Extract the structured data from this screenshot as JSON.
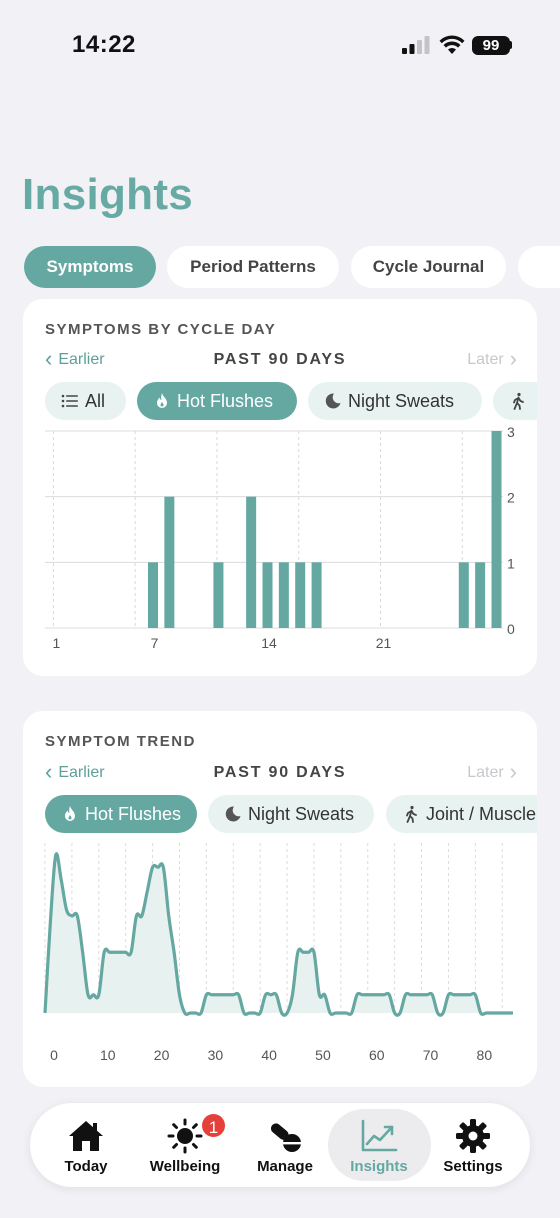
{
  "status": {
    "time": "14:22",
    "battery": "99"
  },
  "page_title": "Insights",
  "top_tabs": [
    {
      "label": "Symptoms",
      "active": true
    },
    {
      "label": "Period Patterns",
      "active": false
    },
    {
      "label": "Cycle Journal",
      "active": false
    }
  ],
  "card1": {
    "title": "SYMPTOMS BY CYCLE DAY",
    "nav_earlier": "Earlier",
    "nav_range": "PAST 90 DAYS",
    "nav_later": "Later",
    "filters": [
      {
        "label": "All",
        "icon": "list-icon",
        "active": false
      },
      {
        "label": "Hot Flushes",
        "icon": "flame-icon",
        "active": true
      },
      {
        "label": "Night Sweats",
        "icon": "moon-icon",
        "active": false
      }
    ]
  },
  "card2": {
    "title": "SYMPTOM TREND",
    "nav_earlier": "Earlier",
    "nav_range": "PAST 90 DAYS",
    "nav_later": "Later",
    "filters": [
      {
        "label": "Hot Flushes",
        "icon": "flame-icon",
        "active": true
      },
      {
        "label": "Night Sweats",
        "icon": "moon-icon",
        "active": false
      },
      {
        "label": "Joint / Muscle",
        "icon": "walking-icon",
        "active": false
      }
    ]
  },
  "tab_bar": {
    "items": [
      {
        "label": "Today",
        "icon": "home-icon",
        "active": false
      },
      {
        "label": "Wellbeing",
        "icon": "sun-icon",
        "active": false,
        "badge": "1"
      },
      {
        "label": "Manage",
        "icon": "pills-icon",
        "active": false
      },
      {
        "label": "Insights",
        "icon": "chart-trend-icon",
        "active": true
      },
      {
        "label": "Settings",
        "icon": "gear-icon",
        "active": false
      }
    ]
  },
  "colors": {
    "accent": "#65a8a2",
    "accent_light": "#e8f3f1",
    "badge": "#e5403a"
  },
  "chart_data": [
    {
      "type": "bar",
      "x": [
        7,
        8,
        11,
        13,
        14,
        15,
        16,
        17,
        26,
        27,
        28
      ],
      "values": [
        1,
        2,
        1,
        2,
        1,
        1,
        1,
        1,
        1,
        1,
        3
      ],
      "xticks": [
        1,
        7,
        14,
        21
      ],
      "yticks": [
        0,
        1,
        2,
        3
      ],
      "xlim": [
        0,
        28
      ],
      "ylim": [
        0,
        3
      ],
      "grid": true
    },
    {
      "type": "area",
      "x": [
        0,
        1,
        2,
        3,
        4,
        5,
        6,
        7,
        8,
        9,
        10,
        11,
        12,
        13,
        14,
        15,
        16,
        17,
        18,
        19,
        20,
        21,
        22,
        23,
        24,
        25,
        26,
        27,
        28,
        29,
        30,
        31,
        32,
        33,
        34,
        35,
        36,
        37,
        38,
        39,
        40,
        41,
        42,
        43,
        44,
        45,
        46,
        47,
        48,
        49,
        50,
        51,
        52,
        53,
        54,
        55,
        56,
        57,
        58,
        59,
        60,
        61,
        62,
        63,
        64,
        65,
        66,
        67,
        68,
        69,
        70,
        71,
        72,
        73,
        74,
        75,
        76,
        77,
        78,
        79,
        80,
        81,
        82,
        83,
        84,
        85,
        86,
        87
      ],
      "values": [
        0,
        1.5,
        2.6,
        2.2,
        1.7,
        1.6,
        1.6,
        1.0,
        0.3,
        0.3,
        0.3,
        1.0,
        1.0,
        1.0,
        1.0,
        1.0,
        1.0,
        1.6,
        1.6,
        2.0,
        2.4,
        2.4,
        2.4,
        1.6,
        1.0,
        0.3,
        0,
        0,
        0,
        0,
        0.3,
        0.3,
        0.3,
        0.3,
        0.3,
        0.3,
        0.3,
        0,
        0,
        0,
        0,
        0.3,
        0.3,
        0.3,
        0,
        0,
        0.3,
        1.0,
        1.0,
        1.0,
        1.0,
        0.3,
        0.3,
        0,
        0,
        0,
        0,
        0,
        0.3,
        0.3,
        0.3,
        0.3,
        0.3,
        0.3,
        0.3,
        0,
        0,
        0.3,
        0.3,
        0.3,
        0.3,
        0.3,
        0.3,
        0,
        0,
        0.3,
        0.3,
        0.3,
        0.3,
        0.3,
        0.3,
        0,
        0,
        0,
        0,
        0,
        0,
        0
      ],
      "xticks": [
        0,
        10,
        20,
        30,
        40,
        50,
        60,
        70,
        80
      ],
      "xlim": [
        0,
        87
      ],
      "ylim": [
        0,
        2.8
      ],
      "grid": true
    }
  ]
}
